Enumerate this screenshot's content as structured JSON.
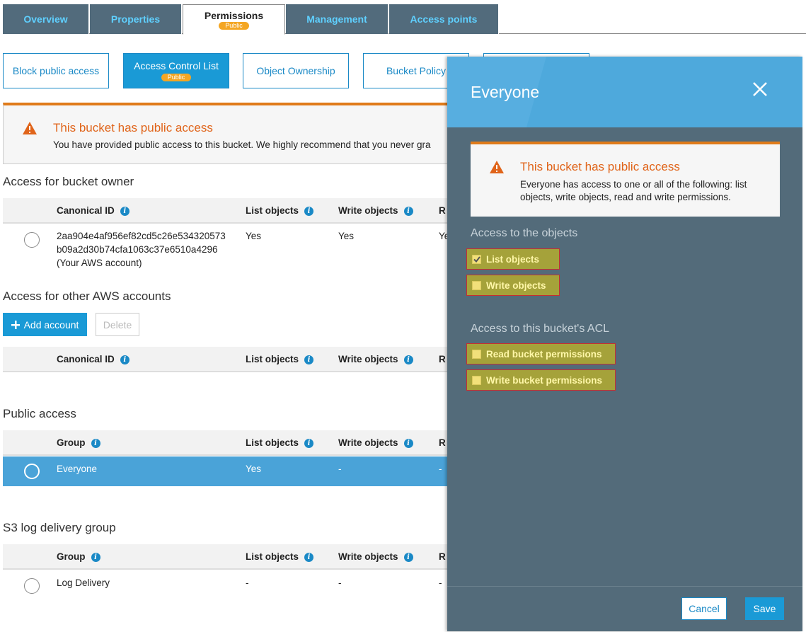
{
  "tabs": [
    {
      "label": "Overview"
    },
    {
      "label": "Properties"
    },
    {
      "label": "Permissions",
      "badge": "Public"
    },
    {
      "label": "Management"
    },
    {
      "label": "Access points"
    }
  ],
  "subtabs": [
    {
      "label": "Block public access"
    },
    {
      "label": "Access Control List",
      "badge": "Public"
    },
    {
      "label": "Object Ownership"
    },
    {
      "label": "Bucket Policy"
    }
  ],
  "warning": {
    "title": "This bucket has public access",
    "text": "You have provided public access to this bucket. We highly recommend that you never gra"
  },
  "owner_section": {
    "title": "Access for bucket owner",
    "headers": {
      "id": "Canonical ID",
      "list": "List objects",
      "write": "Write objects",
      "r": "R"
    },
    "row": {
      "id_line1": "2aa904e4af956ef82cd5c26e534320573",
      "id_line2": "b09a2d30b74cfa1063c37e6510a4296",
      "id_line3": "(Your AWS account)",
      "list": "Yes",
      "write": "Yes",
      "r": "Ye"
    }
  },
  "other_section": {
    "title": "Access for other AWS accounts",
    "add_label": "Add account",
    "delete_label": "Delete",
    "headers": {
      "id": "Canonical ID",
      "list": "List objects",
      "write": "Write objects",
      "r": "R"
    }
  },
  "public_section": {
    "title": "Public access",
    "headers": {
      "group": "Group",
      "list": "List objects",
      "write": "Write objects",
      "r": "R"
    },
    "row": {
      "group": "Everyone",
      "list": "Yes",
      "write": "-",
      "r": "-"
    }
  },
  "log_section": {
    "title": "S3 log delivery group",
    "headers": {
      "group": "Group",
      "list": "List objects",
      "write": "Write objects",
      "r": "R"
    },
    "row": {
      "group": "Log Delivery",
      "list": "-",
      "write": "-",
      "r": "-"
    }
  },
  "modal": {
    "title": "Everyone",
    "warning_title": "This bucket has public access",
    "warning_text": "Everyone has access to one or all of the following: list objects, write objects, read and write permissions.",
    "objects_title": "Access to the objects",
    "acl_title": "Access to this bucket's ACL",
    "options": {
      "list_objects": {
        "label": "List objects",
        "checked": true
      },
      "write_objects": {
        "label": "Write objects",
        "checked": false
      },
      "read_bucket": {
        "label": "Read bucket permissions",
        "checked": false
      },
      "write_bucket": {
        "label": "Write bucket permissions",
        "checked": false
      }
    },
    "cancel_label": "Cancel",
    "save_label": "Save"
  },
  "colors": {
    "accent": "#1a9ad6",
    "warning": "#e0641a",
    "tab_bg": "#526b7c",
    "modal_bg": "#536b7a",
    "highlight": "#a5a23a"
  }
}
